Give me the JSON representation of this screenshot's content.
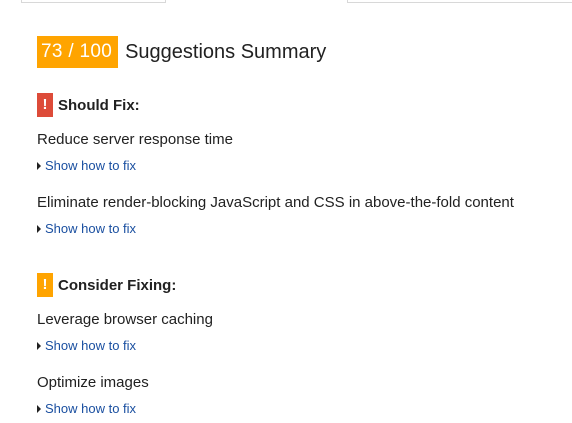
{
  "summary": {
    "score": "73 / 100",
    "title": "Suggestions Summary",
    "badge_color": "#ffa400"
  },
  "should_fix": {
    "label": "Should Fix:",
    "flag_glyph": "!",
    "flag_color": "#dd4b39",
    "rules": [
      {
        "title": "Reduce server response time",
        "link": "Show how to fix"
      },
      {
        "title": "Eliminate render-blocking JavaScript and CSS in above-the-fold content",
        "link": "Show how to fix"
      }
    ]
  },
  "consider_fixing": {
    "label": "Consider Fixing:",
    "flag_glyph": "!",
    "flag_color": "#ffa400",
    "rules": [
      {
        "title": "Leverage browser caching",
        "link": "Show how to fix"
      },
      {
        "title": "Optimize images",
        "link": "Show how to fix"
      }
    ]
  }
}
